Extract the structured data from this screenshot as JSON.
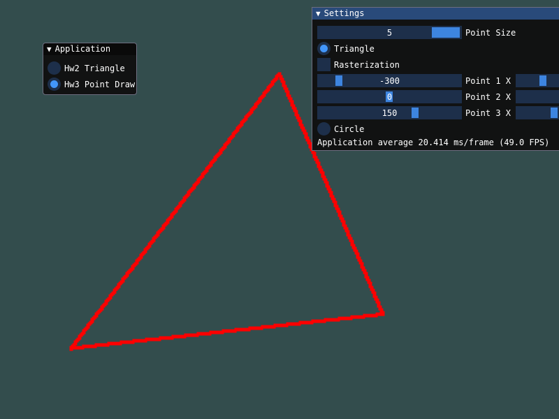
{
  "canvas": {
    "background": "#334d4d",
    "triangle_color": "#ff0000",
    "shape": "triangle"
  },
  "application_window": {
    "title": "Application",
    "options": [
      {
        "label": "Hw2 Triangle",
        "selected": false
      },
      {
        "label": "Hw3 Point Draw",
        "selected": true
      }
    ]
  },
  "settings_window": {
    "title": "Settings",
    "point_size": {
      "value": "5",
      "label": "Point Size",
      "fraction": 0.4
    },
    "triangle": {
      "label": "Triangle",
      "selected": true
    },
    "rasterization": {
      "label": "Rasterization",
      "checked": false
    },
    "points": [
      {
        "x_value": "-300",
        "label": "Point 1 X"
      },
      {
        "x_value": "0",
        "label": "Point 2 X"
      },
      {
        "x_value": "150",
        "label": "Point 3 X"
      }
    ],
    "circle": {
      "label": "Circle",
      "selected": false
    },
    "status_text": "Application average 20.414 ms/frame (49.0 FPS)"
  },
  "colors": {
    "accent": "#4296fa",
    "frame_bg": "#1d2f4a",
    "title_active": "#294a7a"
  },
  "icons": {
    "collapse": "▼"
  }
}
